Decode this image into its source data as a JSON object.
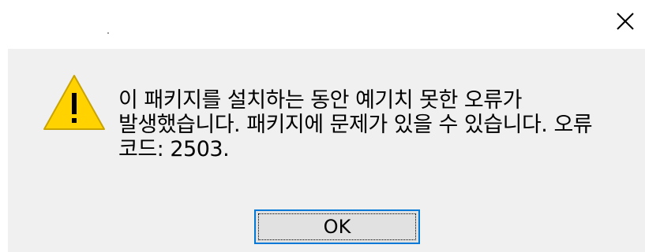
{
  "window": {
    "title": "",
    "close_icon": "close-icon"
  },
  "dialog": {
    "icon": "warning-icon",
    "icon_colors": {
      "fill": "#ffd200",
      "border": "#c9a400",
      "glyph": "#000000"
    },
    "message": "이 패키지를 설치하는 동안 예기치 못한 오류가 발생했습니다. 패키지에 문제가 있을 수 있습니다. 오류 코드: 2503.",
    "ok_label": "OK",
    "accent_color": "#0078d7"
  }
}
